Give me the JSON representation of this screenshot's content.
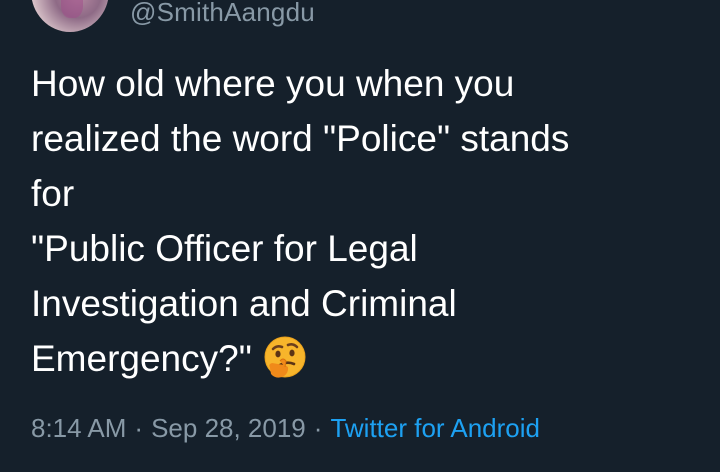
{
  "tweet": {
    "handle": "@SmithAangdu",
    "text_lines": [
      "How old where you when you",
      "realized the word \"Police\" stands",
      "for",
      "\"Public Officer for Legal",
      "Investigation and Criminal",
      "Emergency?\""
    ],
    "emoji": "thinking-face-icon",
    "time": "8:14 AM",
    "date": "Sep 28, 2019",
    "separator": "·",
    "source": "Twitter for Android"
  },
  "colors": {
    "background": "#15202b",
    "text": "#ffffff",
    "secondary": "#8899a6",
    "link": "#1da1f2"
  }
}
